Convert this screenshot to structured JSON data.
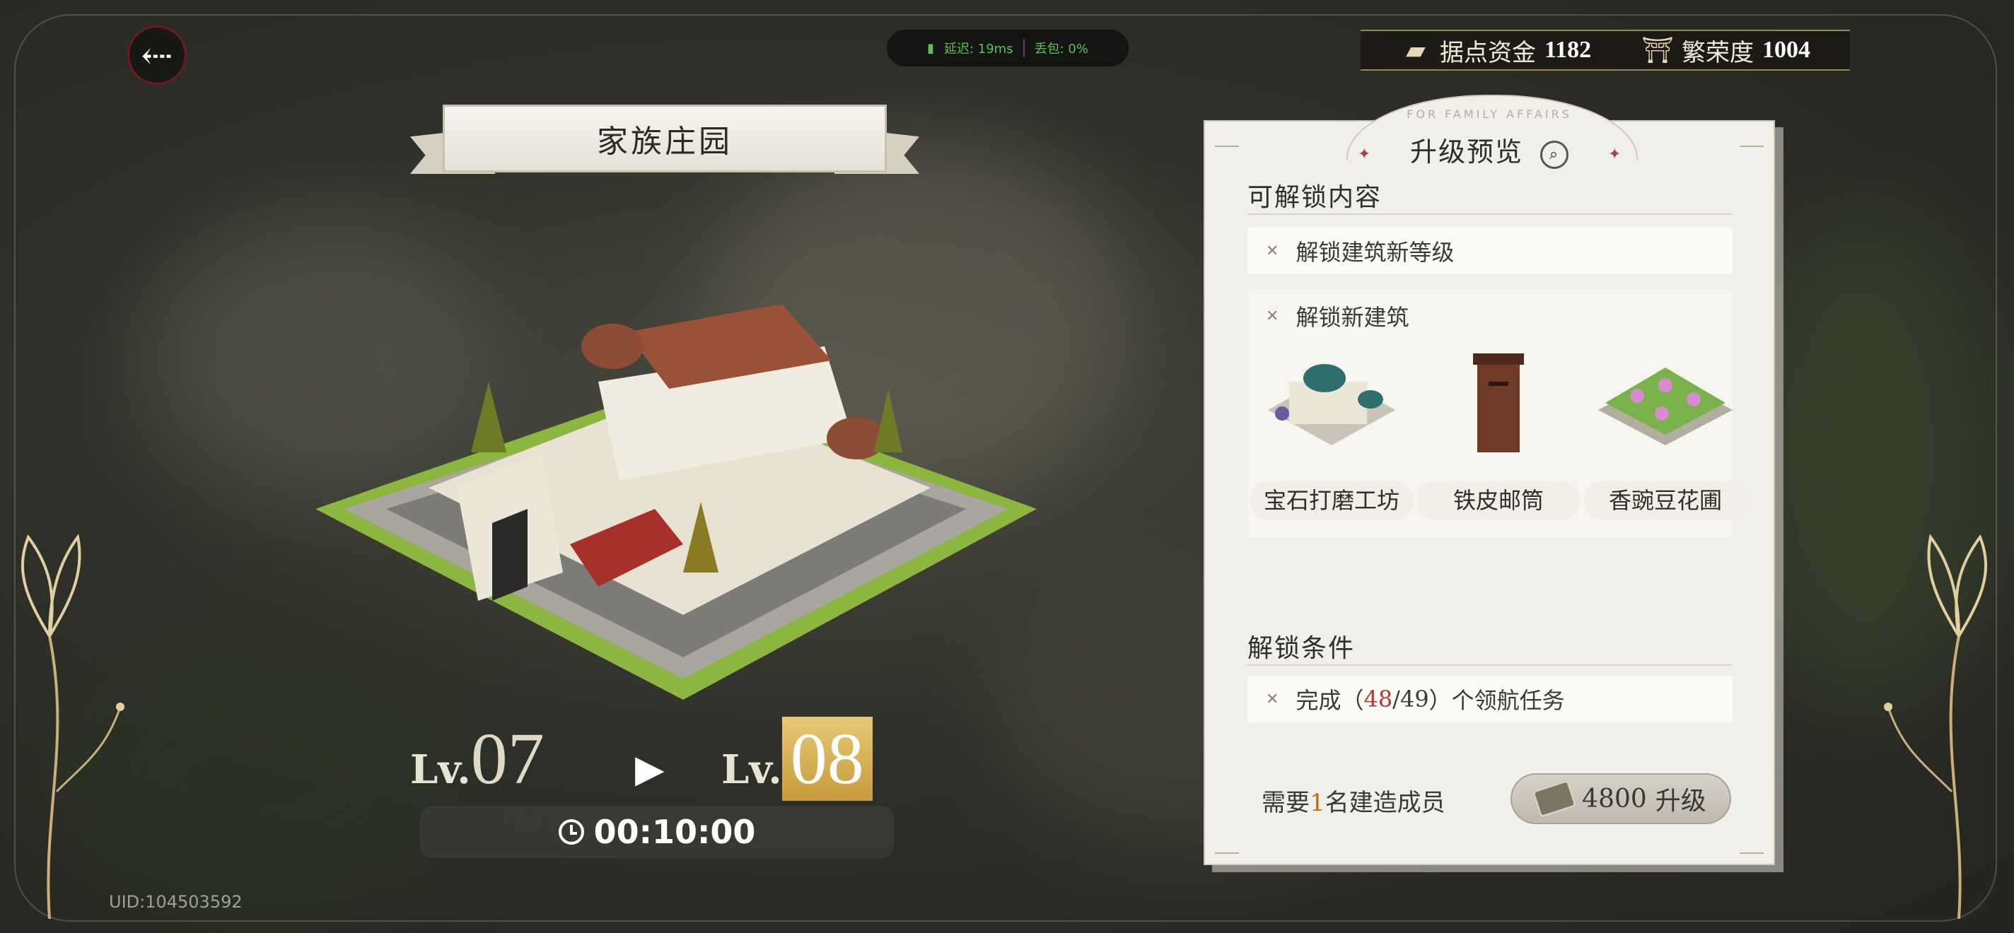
{
  "header": {
    "back_icon": "back-arrow-icon",
    "net": {
      "latency": "延迟: 19ms",
      "loss": "丢包: 0%"
    }
  },
  "resources": [
    {
      "icon": "base-funds-icon",
      "label": "据点资金",
      "value": "1182"
    },
    {
      "icon": "prosperity-icon",
      "label": "繁荣度",
      "value": "1004"
    }
  ],
  "building": {
    "title": "家族庄园"
  },
  "level": {
    "prefix": "Lv.",
    "current": "07",
    "next": "08",
    "arrow": "▶"
  },
  "timer": {
    "value": "00:10:00"
  },
  "uid": "UID:104503592",
  "panel": {
    "arch_text": "FOR FAMILY AFFAIRS",
    "title": "升级预览",
    "unlock_section": "可解锁内容",
    "unlock_level": "解锁建筑新等级",
    "unlock_new": "解锁新建筑",
    "buildings": [
      {
        "name": "宝石打磨工坊",
        "icon": "gem-workshop-icon"
      },
      {
        "name": "铁皮邮筒",
        "icon": "mailbox-icon"
      },
      {
        "name": "香豌豆花圃",
        "icon": "flower-bed-icon"
      }
    ],
    "condition_section": "解锁条件",
    "condition": {
      "pre": "完成（",
      "done": "48",
      "sep": "/",
      "total": "49",
      "post": "）个领航任务"
    },
    "builders": {
      "pre": "需要",
      "count": "1",
      "post": "名建造成员"
    },
    "upgrade": {
      "cost": "4800",
      "label": "升级"
    }
  },
  "colors": {
    "accent_red": "#b2392c",
    "accent_orange": "#c56a16",
    "panel_bg": "#f1efe9"
  }
}
